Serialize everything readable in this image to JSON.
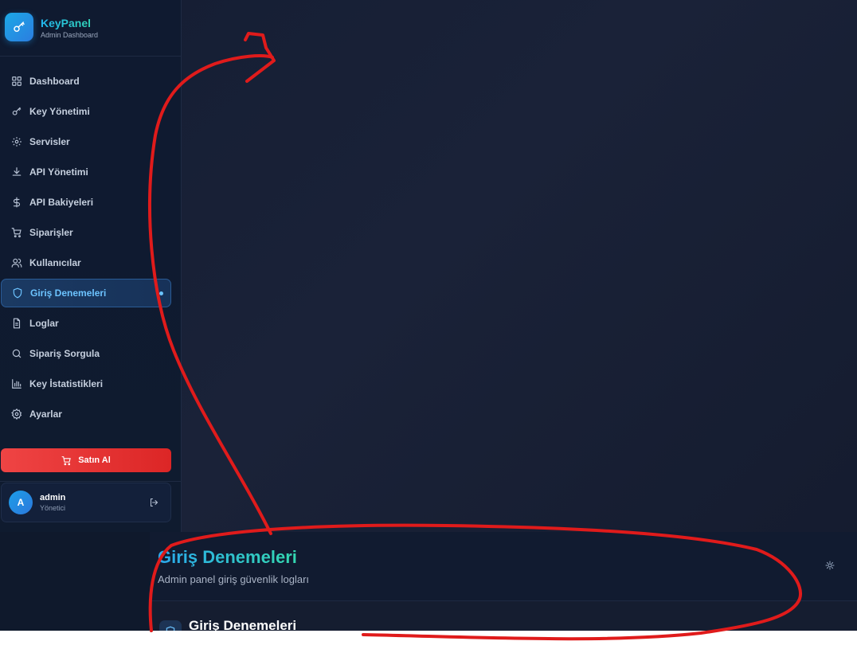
{
  "brand": {
    "title": "KeyPanel",
    "subtitle": "Admin Dashboard"
  },
  "sidebar": {
    "items": [
      {
        "label": "Dashboard",
        "icon": "grid-icon",
        "active": false
      },
      {
        "label": "Key Yönetimi",
        "icon": "key-icon",
        "active": false
      },
      {
        "label": "Servisler",
        "icon": "gear-icon",
        "active": false
      },
      {
        "label": "API Yönetimi",
        "icon": "download-icon",
        "active": false
      },
      {
        "label": "API Bakiyeleri",
        "icon": "dollar-icon",
        "active": false
      },
      {
        "label": "Siparişler",
        "icon": "cart-icon",
        "active": false
      },
      {
        "label": "Kullanıcılar",
        "icon": "users-icon",
        "active": false
      },
      {
        "label": "Giriş Denemeleri",
        "icon": "shield-icon",
        "active": true
      },
      {
        "label": "Loglar",
        "icon": "document-icon",
        "active": false
      },
      {
        "label": "Sipariş Sorgula",
        "icon": "search-icon",
        "active": false
      },
      {
        "label": "Key İstatistikleri",
        "icon": "bar-chart-icon",
        "active": false
      },
      {
        "label": "Ayarlar",
        "icon": "settings-icon",
        "active": false
      }
    ],
    "buy_label": "Satın Al"
  },
  "user": {
    "initial": "A",
    "name": "admin",
    "role": "Yönetici"
  },
  "header": {
    "title": "Giriş Denemeleri",
    "subtitle": "Admin panel giriş güvenlik logları"
  },
  "section": {
    "title": "Giriş Denemeleri"
  },
  "colors": {
    "accent": "#22b8f0",
    "accent2": "#34d8b0",
    "danger": "#ef4444",
    "annotation": "#e01b1b",
    "background": "#141d33"
  }
}
